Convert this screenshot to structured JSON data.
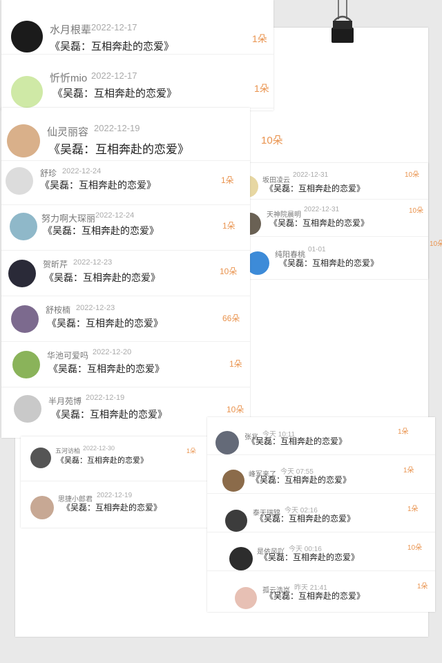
{
  "book_title": "《吴磊：互相奔赴的恋爱》",
  "sheet_left_top": [
    {
      "name": "水月根辈",
      "date": "2022-12-17",
      "count": "1朵",
      "avatar_color": "#1b1b1b"
    },
    {
      "name": "忻忻mio",
      "date": "2022-12-17",
      "count": "1朵",
      "avatar_color": "#cfe9a6"
    }
  ],
  "sheet_left_mid": [
    {
      "name": "仙灵丽容",
      "date": "2022-12-19",
      "count": "10朵",
      "avatar_color": "#d9b08a"
    },
    {
      "name": "舒珍",
      "date": "2022-12-24",
      "count": "1朵",
      "avatar_color": "#dcdcdc"
    },
    {
      "name": "努力啊大琛丽",
      "date": "2022-12-24",
      "count": "1朵",
      "avatar_color": "#8fb8c9"
    },
    {
      "name": "贺昕芹",
      "date": "2022-12-23",
      "count": "10朵",
      "avatar_color": "#2a2a38"
    },
    {
      "name": "舒桉楠",
      "date": "2022-12-23",
      "count": "66朵",
      "avatar_color": "#7c6a8e"
    },
    {
      "name": "华池可爱吗",
      "date": "2022-12-20",
      "count": "1朵",
      "avatar_color": "#8ab35a"
    },
    {
      "name": "半月苑博",
      "date": "2022-12-19",
      "count": "10朵",
      "avatar_color": "#c9c9c9"
    }
  ],
  "sheet_left_bottom": [
    {
      "name": "五河访柏",
      "date": "2022-12-30",
      "count": "1朵",
      "avatar_color": "#555"
    },
    {
      "name": "思捷小郎君",
      "date": "2022-12-19",
      "count": "1朵",
      "avatar_color": "#c7a894"
    }
  ],
  "sheet_right_top": [
    {
      "name": "坂田凌云",
      "date": "2022-12-31",
      "count": "10朵",
      "avatar_color": "#e7d7a2"
    },
    {
      "name": "天神院晨明",
      "date": "2022-12-31",
      "count": "10朵",
      "avatar_color": "#6a6154"
    },
    {
      "name": "纯阳春桃",
      "date": "01-01",
      "count": "10朵",
      "avatar_color": "#3d8bd8"
    }
  ],
  "sheet_right_bottom": [
    {
      "name": "张兆",
      "date": "今天 10:11",
      "count": "1朵",
      "avatar_color": "#646a78"
    },
    {
      "name": "峰军来了",
      "date": "今天 07:55",
      "count": "1朵",
      "avatar_color": "#8b6b4a"
    },
    {
      "name": "泰天瑞锦",
      "date": "今天 02:16",
      "count": "1朵",
      "avatar_color": "#3c3c3c"
    },
    {
      "name": "是依风吖",
      "date": "今天 00:16",
      "count": "10朵",
      "avatar_color": "#2d2d2d"
    },
    {
      "name": "孤云浩岚",
      "date": "昨天 21:41",
      "count": "1朵",
      "avatar_color": "#e7c0b4"
    }
  ]
}
